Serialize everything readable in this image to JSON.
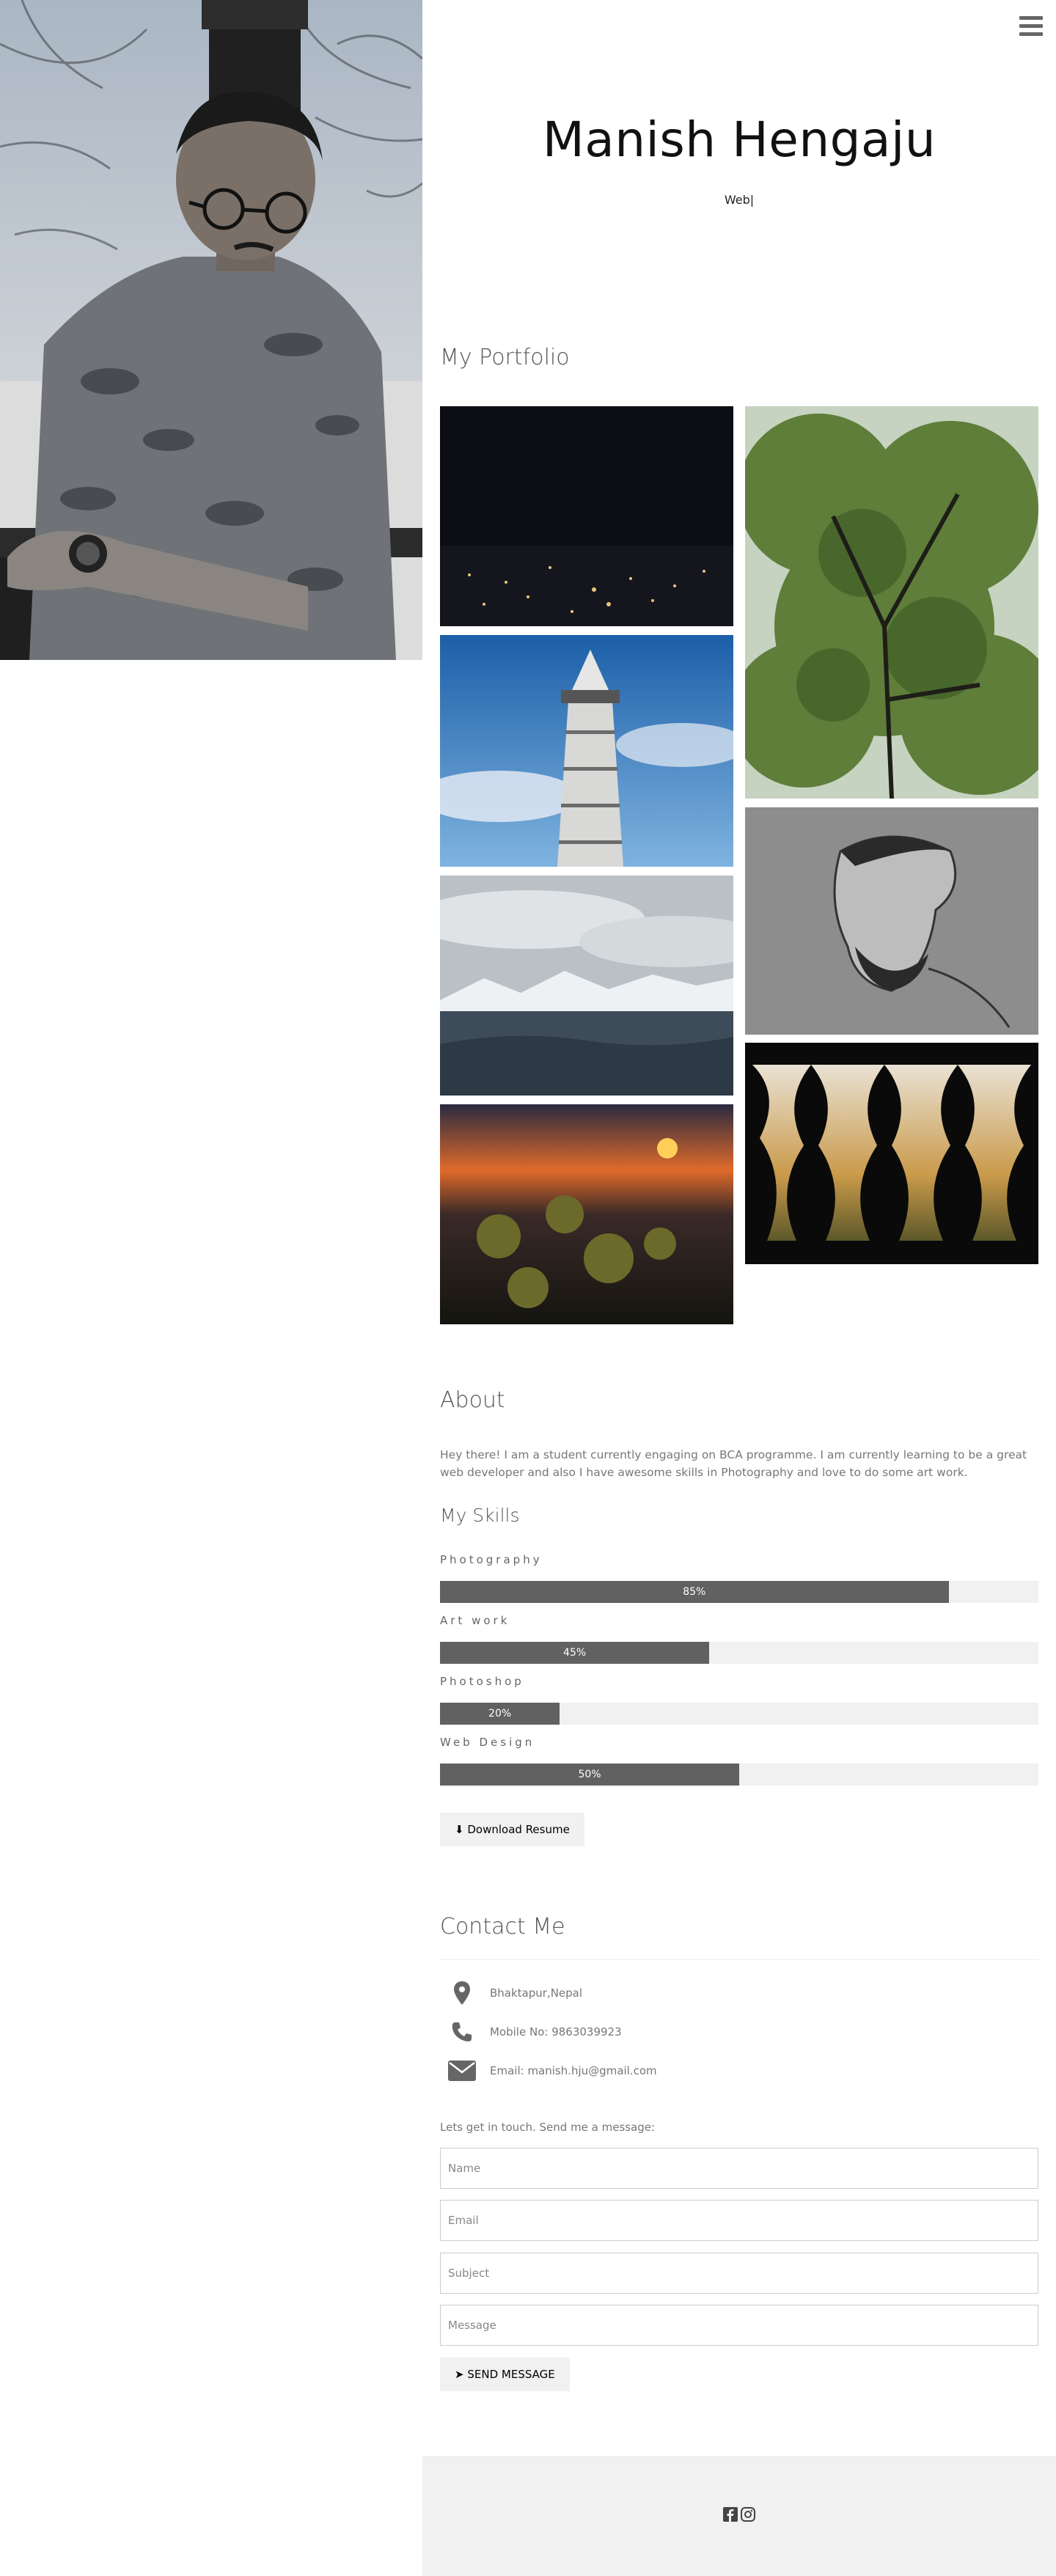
{
  "header": {
    "name": "Manish Hengaju",
    "tagline": "Web|"
  },
  "portfolio": {
    "title": "My Portfolio",
    "photos": [
      {
        "subject": "city lights at night"
      },
      {
        "subject": "green tree canopy"
      },
      {
        "subject": "white tower against blue sky"
      },
      {
        "subject": "pencil sketch of a man"
      },
      {
        "subject": "snowy mountains and clouds"
      },
      {
        "subject": "carved wooden balusters at sunset"
      },
      {
        "subject": "flowers at sunset"
      }
    ]
  },
  "about": {
    "title": "About",
    "text": "Hey there! I am a student currently engaging on BCA programme. I am currently learning to be a great web developer and also I have awesome skills in Photography and love to do some art work."
  },
  "skills": {
    "title": "My Skills",
    "items": [
      {
        "name": "Photography",
        "percent": 85,
        "label": "85%"
      },
      {
        "name": "Art work",
        "percent": 45,
        "label": "45%"
      },
      {
        "name": "Photoshop",
        "percent": 20,
        "label": "20%"
      },
      {
        "name": "Web Design",
        "percent": 50,
        "label": "50%"
      }
    ],
    "download_label": "Download Resume"
  },
  "contact": {
    "title": "Contact Me",
    "address": "Bhaktapur,Nepal",
    "phone": "Mobile No: 9863039923",
    "email": "Email: manish.hju@gmail.com",
    "touch_text": "Lets get in touch. Send me a message:",
    "form": {
      "name_placeholder": "Name",
      "email_placeholder": "Email",
      "subject_placeholder": "Subject",
      "message_placeholder": "Message"
    },
    "send_label": "SEND MESSAGE"
  },
  "footer": {
    "icons": [
      "facebook-icon",
      "instagram-icon"
    ]
  },
  "colors": {
    "bar_fill": "#616161",
    "bar_track": "#f1f1f1",
    "button_bg": "#f1f1f1",
    "footer_bg": "#f1f1f1"
  }
}
